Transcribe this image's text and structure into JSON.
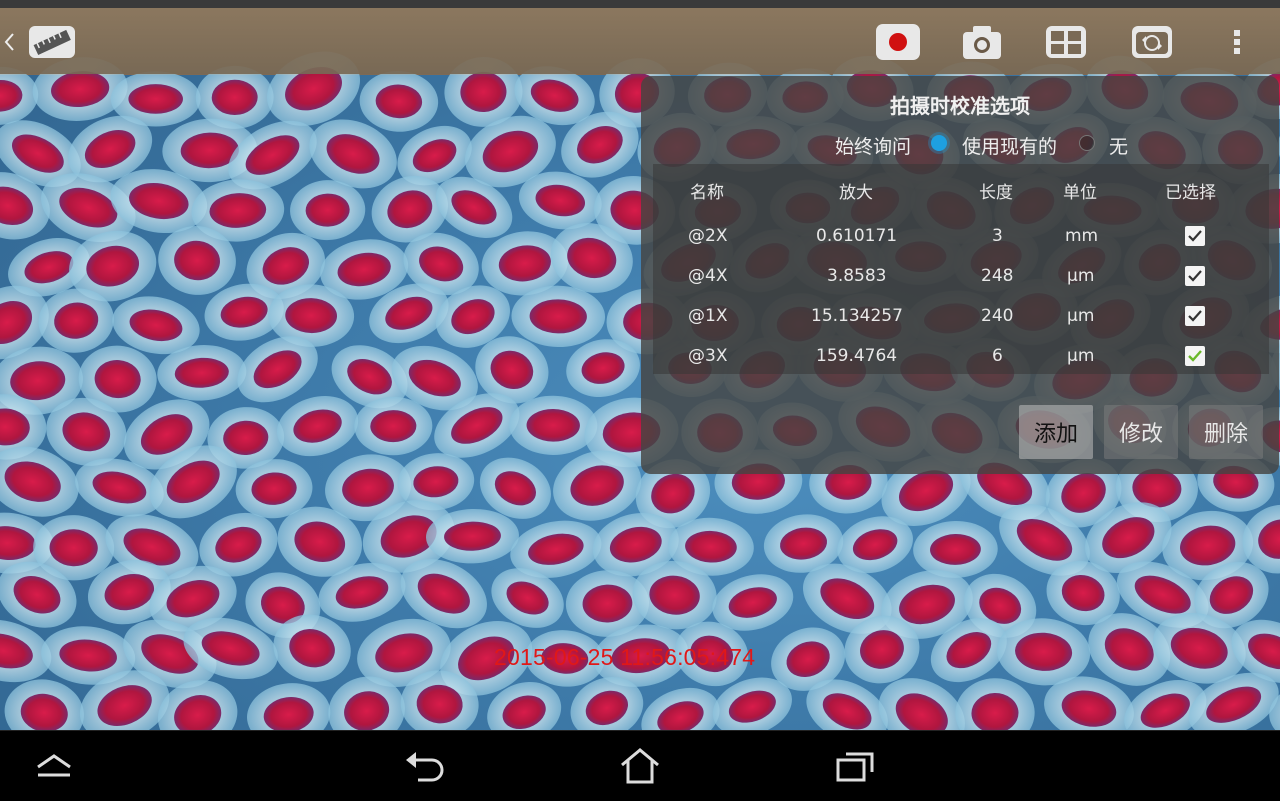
{
  "actionbar": {
    "icons": [
      "chevron-left-icon",
      "ruler-icon",
      "record-icon",
      "camera-icon",
      "grid-icon",
      "switch-camera-icon",
      "more-vertical-icon"
    ]
  },
  "panel": {
    "title": "拍摄时校准选项",
    "radio": {
      "always_ask": "始终询问",
      "use_existing": "使用现有的",
      "none": "无",
      "selected": "use_existing"
    },
    "table": {
      "headers": [
        "名称",
        "放大",
        "长度",
        "单位",
        "已选择"
      ],
      "rows": [
        {
          "name": "@2X",
          "magnification": "0.610171",
          "length": "3",
          "unit": "mm",
          "selected": true
        },
        {
          "name": "@4X",
          "magnification": "3.8583",
          "length": "248",
          "unit": "μm",
          "selected": true
        },
        {
          "name": "@1X",
          "magnification": "15.134257",
          "length": "240",
          "unit": "μm",
          "selected": true
        },
        {
          "name": "@3X",
          "magnification": "159.4764",
          "length": "6",
          "unit": "μm",
          "selected": true
        }
      ]
    },
    "buttons": {
      "add": "添加",
      "modify": "修改",
      "delete": "删除"
    }
  },
  "overlay": {
    "timestamp": "2015-06-25 11:56:05:474"
  },
  "navbar": {
    "icons": [
      "collapse-icon",
      "back-icon",
      "home-icon",
      "recent-apps-icon"
    ]
  },
  "colors": {
    "accent": "#1ea0e0",
    "timestamp": "#e01818",
    "check_green": "#6ab82a"
  }
}
